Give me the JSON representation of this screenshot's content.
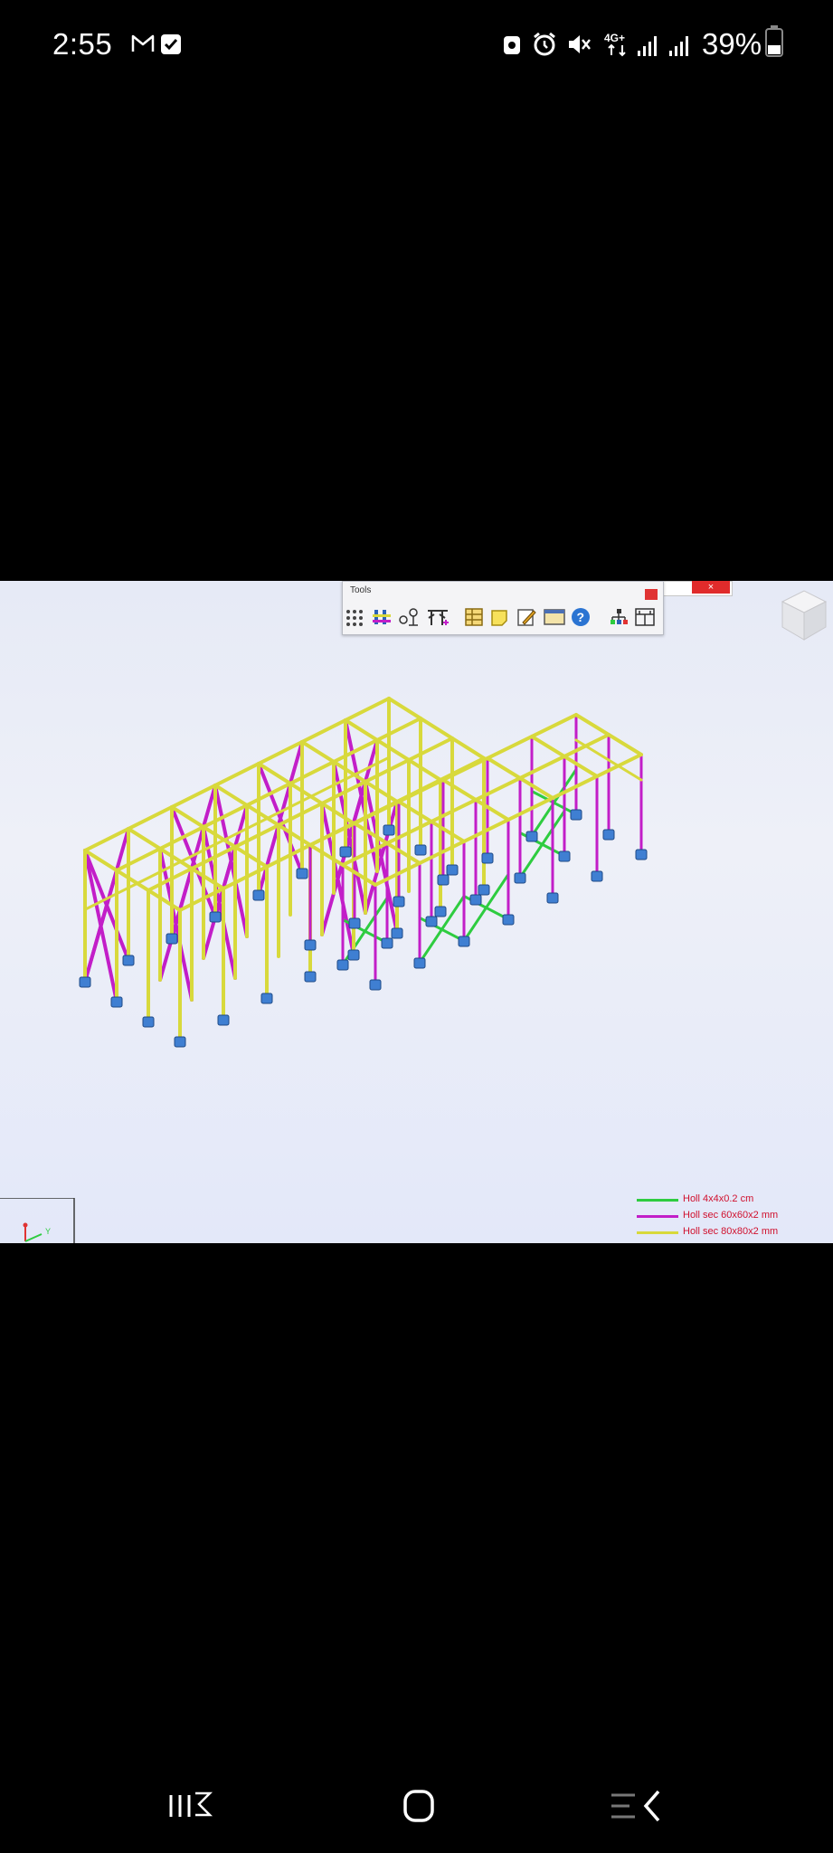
{
  "status_bar": {
    "time": "2:55",
    "battery": "39%",
    "network": "4G+",
    "icons": [
      "gmail-icon",
      "checkbox-notification-icon",
      "camera-alert-icon",
      "alarm-icon",
      "mute-icon",
      "4g-plus-icon",
      "signal-icon",
      "signal-icon",
      "battery-icon"
    ]
  },
  "app": {
    "toolbar": {
      "title": "Tools",
      "tools": [
        "grid-dots-icon",
        "structure-icon",
        "nodes-icon",
        "bars-icon",
        "table-icon",
        "note-icon",
        "edit-icon",
        "window-icon",
        "help-icon",
        "hierarchy-icon",
        "layout-icon"
      ]
    },
    "close_label": "×",
    "view_cube": "view-cube-icon",
    "axes_indicator": "xyz-axes-icon",
    "legend": [
      {
        "label": "Holl 4x4x0.2 cm",
        "color": "#2ecc40"
      },
      {
        "label": "Holl sec 60x60x2 mm",
        "color": "#c21ec8"
      },
      {
        "label": "Holl sec 80x80x2 mm",
        "color": "#d8d93c"
      }
    ],
    "colors": {
      "beam": "#d8d93c",
      "brace": "#c21ec8",
      "bottom_brace": "#2ecc40",
      "support": "#3f7fd2",
      "background": "#e6eaf6"
    }
  },
  "nav_bar": {
    "buttons": [
      "recent-apps-icon",
      "home-icon",
      "back-icon"
    ]
  }
}
